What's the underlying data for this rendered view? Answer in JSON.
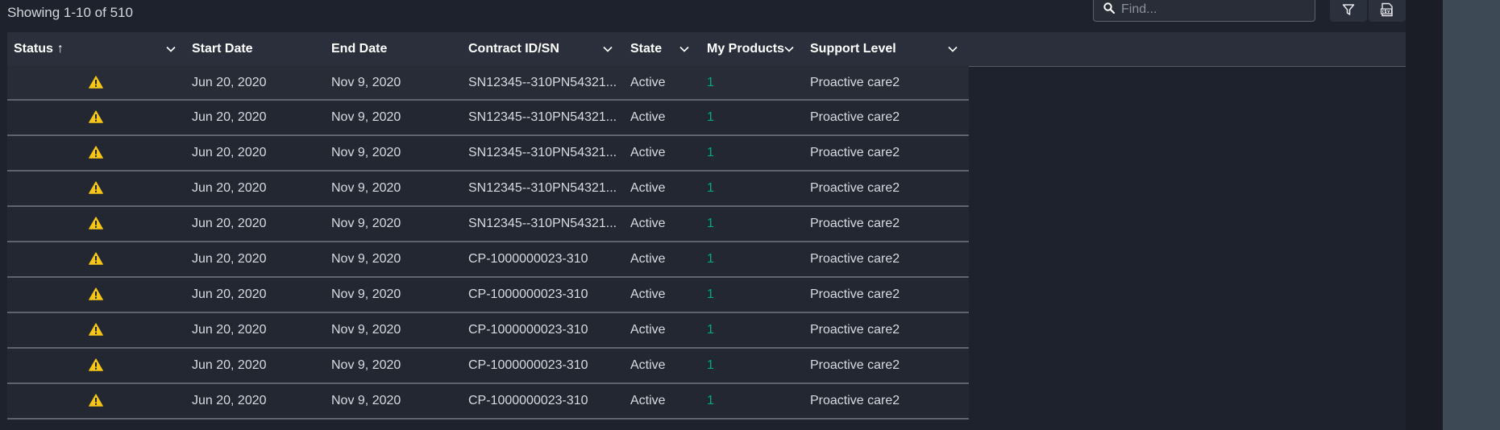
{
  "summary": "Showing 1-10 of 510",
  "search": {
    "placeholder": "Find..."
  },
  "toolbar": {
    "filter_icon": "filter-icon",
    "csv_icon": "csv-export-icon"
  },
  "colors": {
    "warning": "#f5c518",
    "products_link": "#01a982",
    "background": "#1e222c"
  },
  "columns": [
    {
      "label": "Status",
      "sort": "↑"
    },
    {
      "label": "Start Date"
    },
    {
      "label": "End Date"
    },
    {
      "label": "Contract ID/SN"
    },
    {
      "label": "State"
    },
    {
      "label": "My Products"
    },
    {
      "label": "Support Level"
    }
  ],
  "rows": [
    {
      "status_icon": "warning-icon",
      "start": "Jun 20, 2020",
      "end": "Nov 9, 2020",
      "contract": "SN12345--310PN54321...",
      "state": "Active",
      "products": "1",
      "support": "Proactive care2"
    },
    {
      "status_icon": "warning-icon",
      "start": "Jun 20, 2020",
      "end": "Nov 9, 2020",
      "contract": "SN12345--310PN54321...",
      "state": "Active",
      "products": "1",
      "support": "Proactive care2"
    },
    {
      "status_icon": "warning-icon",
      "start": "Jun 20, 2020",
      "end": "Nov 9, 2020",
      "contract": "SN12345--310PN54321...",
      "state": "Active",
      "products": "1",
      "support": "Proactive care2"
    },
    {
      "status_icon": "warning-icon",
      "start": "Jun 20, 2020",
      "end": "Nov 9, 2020",
      "contract": "SN12345--310PN54321...",
      "state": "Active",
      "products": "1",
      "support": "Proactive care2"
    },
    {
      "status_icon": "warning-icon",
      "start": "Jun 20, 2020",
      "end": "Nov 9, 2020",
      "contract": "SN12345--310PN54321...",
      "state": "Active",
      "products": "1",
      "support": "Proactive care2"
    },
    {
      "status_icon": "warning-icon",
      "start": "Jun 20, 2020",
      "end": "Nov 9, 2020",
      "contract": "CP-1000000023-310",
      "state": "Active",
      "products": "1",
      "support": "Proactive care2"
    },
    {
      "status_icon": "warning-icon",
      "start": "Jun 20, 2020",
      "end": "Nov 9, 2020",
      "contract": "CP-1000000023-310",
      "state": "Active",
      "products": "1",
      "support": "Proactive care2"
    },
    {
      "status_icon": "warning-icon",
      "start": "Jun 20, 2020",
      "end": "Nov 9, 2020",
      "contract": "CP-1000000023-310",
      "state": "Active",
      "products": "1",
      "support": "Proactive care2"
    },
    {
      "status_icon": "warning-icon",
      "start": "Jun 20, 2020",
      "end": "Nov 9, 2020",
      "contract": "CP-1000000023-310",
      "state": "Active",
      "products": "1",
      "support": "Proactive care2"
    },
    {
      "status_icon": "warning-icon",
      "start": "Jun 20, 2020",
      "end": "Nov 9, 2020",
      "contract": "CP-1000000023-310",
      "state": "Active",
      "products": "1",
      "support": "Proactive care2"
    }
  ]
}
